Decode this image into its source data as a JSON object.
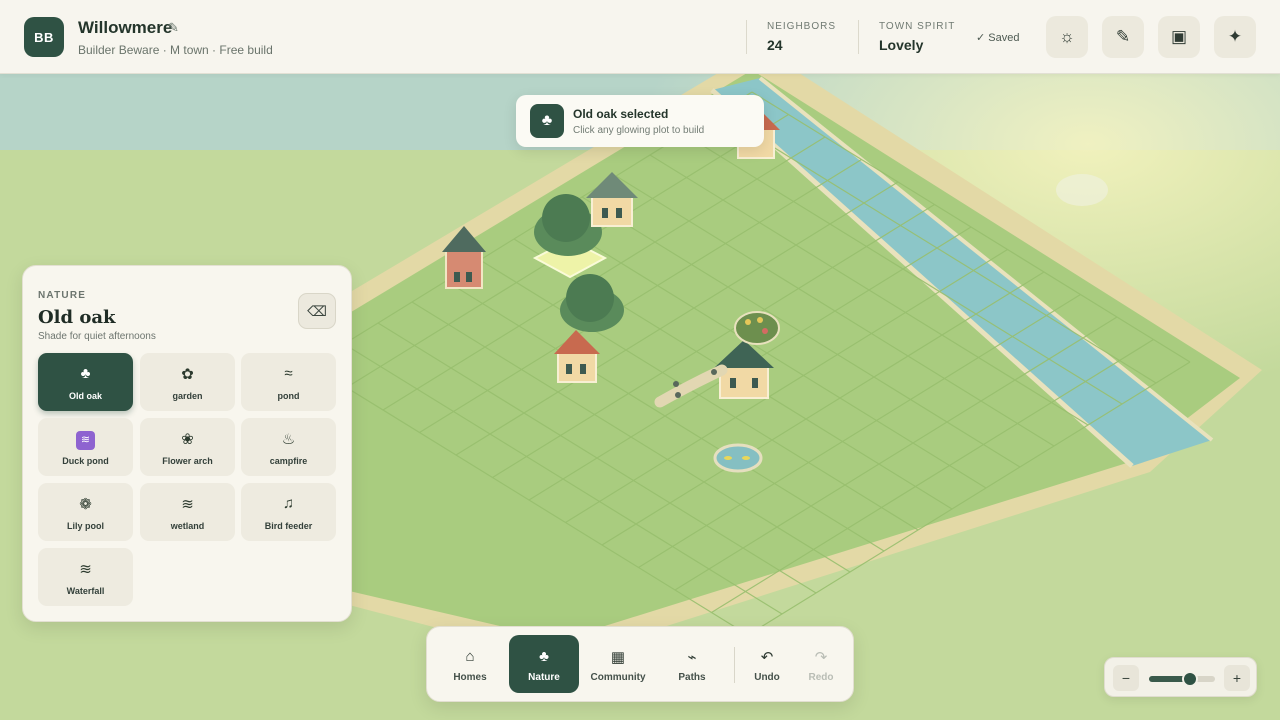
{
  "app": {
    "logo_text": "BB",
    "town_name": "Willowmere",
    "subtitle": "Builder Beware · M town · Free build",
    "edit_icon": "pencil-icon"
  },
  "stats": {
    "neighbors_label": "NEIGHBORS",
    "neighbors_value": "24",
    "spirit_label": "TOWN SPIRIT",
    "spirit_value": "Lovely",
    "saved_text": "✓ Saved"
  },
  "top_buttons": [
    {
      "name": "sun-icon",
      "glyph": "☼"
    },
    {
      "name": "pencil-icon",
      "glyph": "✎"
    },
    {
      "name": "frame-icon",
      "glyph": "▣"
    },
    {
      "name": "sparkle-icon",
      "glyph": "✦"
    }
  ],
  "toast": {
    "icon": "club-icon",
    "title": "Old oak selected",
    "subtitle": "Click any glowing plot to build"
  },
  "panel": {
    "category": "NATURE",
    "title": "Old oak",
    "description": "Shade for quiet afternoons",
    "erase_icon": "erase-icon",
    "items": [
      {
        "label": "Old oak",
        "icon": "club-icon",
        "glyph": "♣",
        "active": true
      },
      {
        "label": "garden",
        "icon": "flower-icon",
        "glyph": "✿",
        "active": false
      },
      {
        "label": "pond",
        "icon": "wave-icon",
        "glyph": "≈",
        "active": false
      },
      {
        "label": "Duck pond",
        "icon": "water-badge-icon",
        "glyph": "≋",
        "active": false
      },
      {
        "label": "Flower arch",
        "icon": "blossom-icon",
        "glyph": "❀",
        "active": false
      },
      {
        "label": "campfire",
        "icon": "campfire-icon",
        "glyph": "♨",
        "active": false
      },
      {
        "label": "Lily pool",
        "icon": "lily-icon",
        "glyph": "❁",
        "active": false
      },
      {
        "label": "wetland",
        "icon": "wetland-icon",
        "glyph": "≋",
        "active": false
      },
      {
        "label": "Bird feeder",
        "icon": "music-note-icon",
        "glyph": "♫",
        "active": false
      },
      {
        "label": "Waterfall",
        "icon": "waterfall-icon",
        "glyph": "≋",
        "active": false
      }
    ]
  },
  "toolbar": {
    "items": [
      {
        "label": "Homes",
        "icon": "home-icon",
        "glyph": "⌂",
        "state": "normal"
      },
      {
        "label": "Nature",
        "icon": "club-icon",
        "glyph": "♣",
        "state": "active"
      },
      {
        "label": "Community",
        "icon": "grid-icon",
        "glyph": "▦",
        "state": "normal"
      },
      {
        "label": "Paths",
        "icon": "path-icon",
        "glyph": "⌁",
        "state": "normal"
      },
      {
        "label": "Undo",
        "icon": "undo-icon",
        "glyph": "↶",
        "state": "normal"
      },
      {
        "label": "Redo",
        "icon": "redo-icon",
        "glyph": "↷",
        "state": "disabled"
      }
    ]
  },
  "zoom": {
    "minus": "−",
    "plus": "+",
    "level": 0.62
  },
  "colors": {
    "accent": "#2f5244",
    "grass": "#a8cb7e",
    "river": "#8cc6c8",
    "roof_red": "#c86a4f",
    "roof_green": "#4f6b5f"
  }
}
